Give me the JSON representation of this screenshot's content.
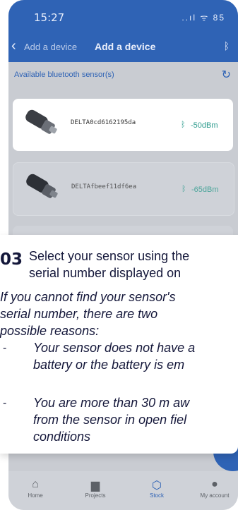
{
  "status": {
    "time": "15:27",
    "signal": "..ıl ᯤ 85"
  },
  "header": {
    "back_crumb": "Add a device",
    "title": "Add a device"
  },
  "section": {
    "title": "Available bluetooth sensor(s)"
  },
  "devices": [
    {
      "name": "DELTA0cd6162195da",
      "rssi": "-50dBm"
    },
    {
      "name": "DELTAfbeef11df6ea",
      "rssi": "-65dBm"
    }
  ],
  "overlay": {
    "step_number": "03",
    "step_line1": "Select your sensor using the",
    "step_line2": "serial number displayed on",
    "intro_line1": "If you cannot find your sensor's",
    "intro_line2": "serial number, there are two",
    "intro_line3": "possible reasons:",
    "reason1_line1": "Your sensor does not have a",
    "reason1_line2": "battery or the battery is em",
    "reason2_line1": "You are more than 30 m aw",
    "reason2_line2": "from the sensor in open fiel",
    "reason2_line3": "conditions",
    "dash": "-"
  },
  "tabs": [
    {
      "label": "Home"
    },
    {
      "label": "Projects"
    },
    {
      "label": "Stock"
    },
    {
      "label": "My account"
    }
  ],
  "colors": {
    "primary": "#2f63b5",
    "rssi": "#2d9b8d"
  }
}
